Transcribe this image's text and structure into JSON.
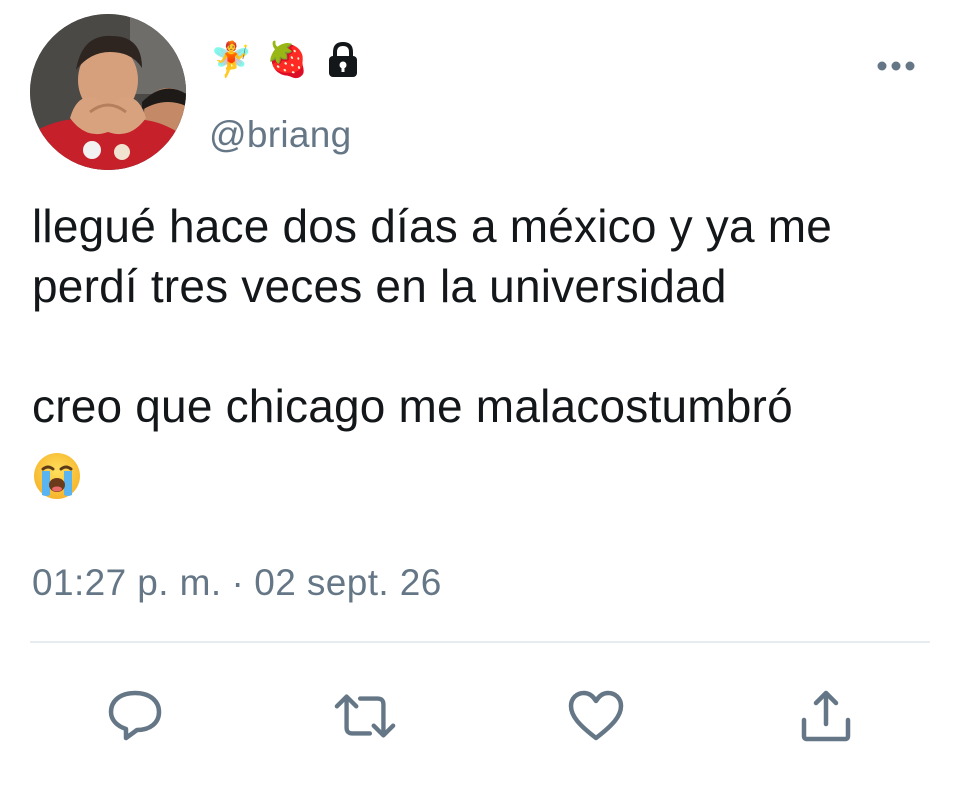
{
  "user": {
    "handle": "@briang",
    "name_emojis": [
      "🧚",
      "🍓"
    ],
    "protected_icon": "lock-icon",
    "avatar_icon": "profile-photo"
  },
  "tweet": {
    "paragraphs": [
      "llegué hace dos días a méxico y ya me perdí tres veces en la universidad",
      "creo que chicago me malacostumbró"
    ],
    "trailing_emoji": "loudly-crying-face-emoji",
    "time": "01:27 p. m.",
    "separator": "·",
    "date": "02 sept. 26"
  },
  "actions": {
    "reply_icon": "reply-icon",
    "retweet_icon": "retweet-icon",
    "like_icon": "heart-icon",
    "share_icon": "share-icon"
  },
  "colors": {
    "text": "#14171a",
    "secondary": "#657786",
    "divider": "#e6ecf0"
  }
}
